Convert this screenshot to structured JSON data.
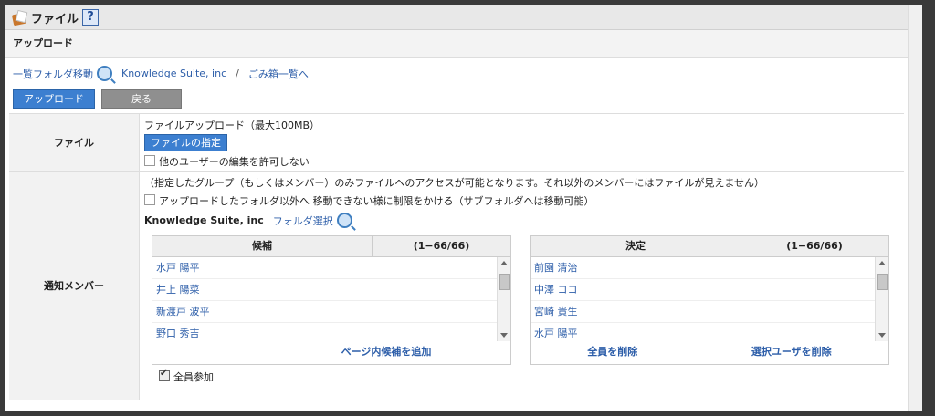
{
  "header": {
    "title": "ファイル",
    "help": "?"
  },
  "subbar": {
    "title": "アップロード"
  },
  "links": {
    "folder_move": "一覧フォルダ移動",
    "company": "Knowledge Suite, inc",
    "separator": "/",
    "trash": "ごみ箱一覧へ"
  },
  "toolbar": {
    "upload_label": "アップロード",
    "back_label": "戻る"
  },
  "file_row": {
    "label": "ファイル",
    "caption": "ファイルアップロード（最大100MB）",
    "select_button": "ファイルの指定",
    "no_edit_label": "他のユーザーの編集を許可しない"
  },
  "notify_row": {
    "label": "通知メンバー",
    "notice": "（指定したグループ（もしくはメンバー）のみファイルへのアクセスが可能となります。それ以外のメンバーにはファイルが見えません）",
    "restrict_label": "アップロードしたフォルダ以外へ 移動できない様に制限をかける（サブフォルダへは移動可能）",
    "company": "Knowledge Suite, inc",
    "folder_select": "フォルダ選択",
    "candidates": {
      "header": "候補",
      "count": "(1−66/66)",
      "items": [
        "水戸 陽平",
        "井上 陽菜",
        "新渡戸 波平",
        "野口 秀吉"
      ],
      "add_page": "ページ内候補を追加"
    },
    "decided": {
      "header": "決定",
      "count": "(1−66/66)",
      "items": [
        "前園 清治",
        "中澤 ココ",
        "宮崎 貴生",
        "水戸 陽平"
      ],
      "remove_all": "全員を削除",
      "remove_selected": "選択ユーザを削除"
    },
    "all_join": "全員参加"
  }
}
